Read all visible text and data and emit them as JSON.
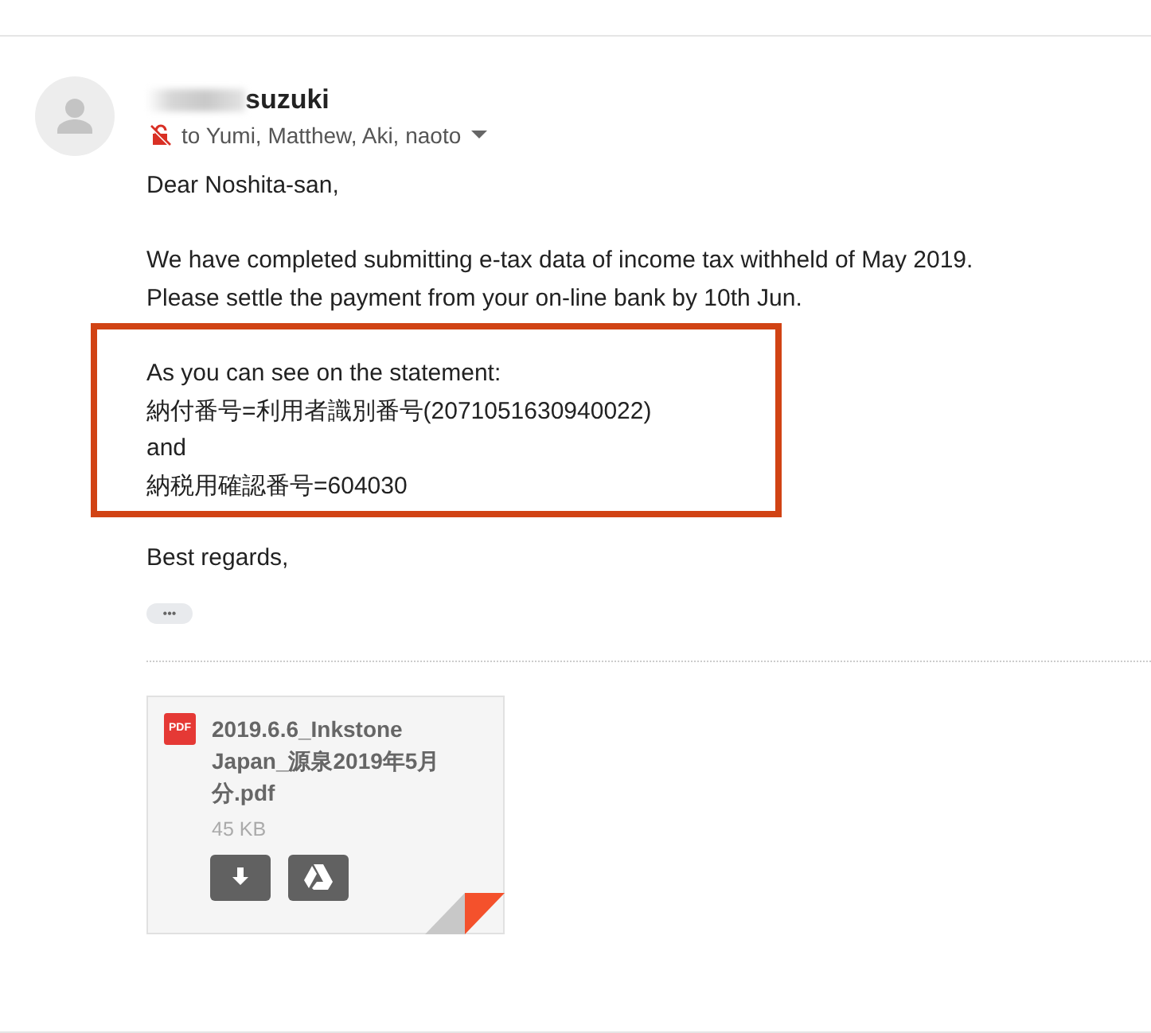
{
  "sender": {
    "name": "suzuki",
    "recipients": "to Yumi, Matthew, Aki, naoto"
  },
  "body": {
    "greeting": "Dear Noshita-san,",
    "paragraph": [
      "We have completed submitting e-tax data of income tax withheld of May 2019.",
      "Please settle the payment from your on-line bank by 10th Jun."
    ],
    "highlighted": [
      "As you can see on the statement:",
      "納付番号=利用者識別番号(2071051630940022)",
      "and",
      "納税用確認番号=604030"
    ],
    "closing": "Best regards,"
  },
  "show_trimmed": "•••",
  "attachment": {
    "type_badge": "PDF",
    "filename": "2019.6.6_Inkstone Japan_源泉2019年5月分.pdf",
    "size": "45 KB"
  }
}
